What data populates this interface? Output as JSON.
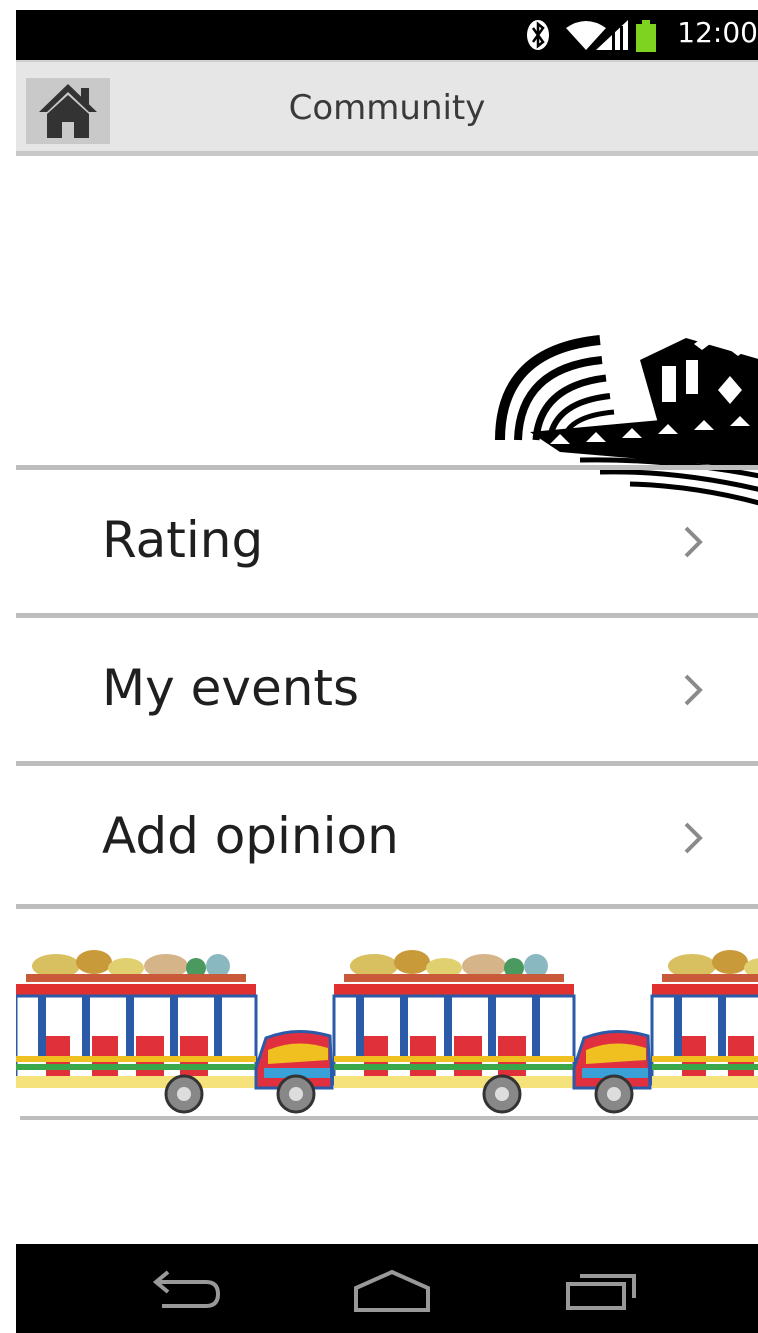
{
  "status_bar": {
    "time": "12:00",
    "battery_color": "#7ed321"
  },
  "app_bar": {
    "title": "Community",
    "home_button": "home-icon"
  },
  "menu": {
    "items": [
      {
        "label": "Rating"
      },
      {
        "label": "My events"
      },
      {
        "label": "Add opinion"
      }
    ]
  },
  "nav_bar": {
    "buttons": [
      "back-icon",
      "home-outline-icon",
      "recent-apps-icon"
    ]
  },
  "colors": {
    "app_bar_bg": "#e6e6e6",
    "divider": "#bdbdbd",
    "text": "#1f1f1f"
  }
}
